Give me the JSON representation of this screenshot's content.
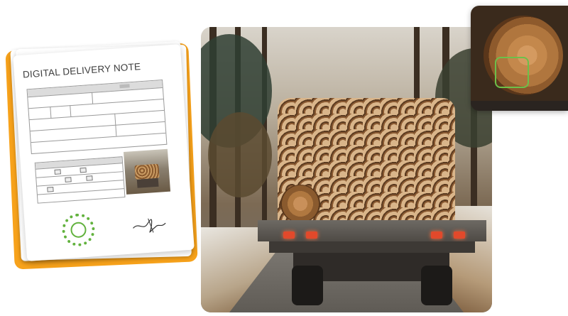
{
  "document": {
    "title": "DIGITAL DELIVERY NOTE",
    "stamp_color": "#62b23e",
    "folder_color": "#f7a21b"
  },
  "photo": {
    "subject": "timber-truck-photo"
  },
  "inset": {
    "tag_text": "",
    "highlight_color": "#6cc04a"
  }
}
